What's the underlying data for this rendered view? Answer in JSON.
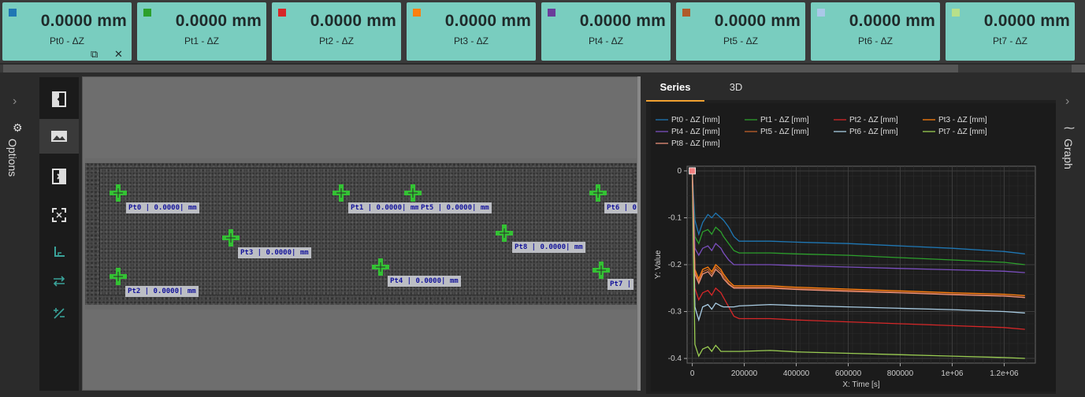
{
  "cards": [
    {
      "value": "0.0000 mm",
      "label": "Pt0 -  ΔZ",
      "color": "#1f77b4"
    },
    {
      "value": "0.0000 mm",
      "label": "Pt1 -  ΔZ",
      "color": "#2ca02c"
    },
    {
      "value": "0.0000 mm",
      "label": "Pt2 -  ΔZ",
      "color": "#d62728"
    },
    {
      "value": "0.0000 mm",
      "label": "Pt3 -  ΔZ",
      "color": "#ff7f0e"
    },
    {
      "value": "0.0000 mm",
      "label": "Pt4 -  ΔZ",
      "color": "#6a3d9a"
    },
    {
      "value": "0.0000 mm",
      "label": "Pt5 -  ΔZ",
      "color": "#b05a2a"
    },
    {
      "value": "0.0000 mm",
      "label": "Pt6 -  ΔZ",
      "color": "#aac8e8"
    },
    {
      "value": "0.0000 mm",
      "label": "Pt7 -  ΔZ",
      "color": "#b8e08a"
    }
  ],
  "card_tools": {
    "copy_icon": "⧉",
    "close_icon": "✕"
  },
  "options_label": "Options",
  "graph_label": "Graph",
  "tabs": [
    {
      "label": "Series"
    },
    {
      "label": "3D"
    }
  ],
  "points": [
    {
      "label": "Pt0 | 0.0000| mm"
    },
    {
      "label": "Pt1 | 0.0000| mm"
    },
    {
      "label": "Pt5 | 0.0000| mm"
    },
    {
      "label": "Pt6 | 0"
    },
    {
      "label": "Pt3 | 0.0000| mm"
    },
    {
      "label": "Pt8 | 0.0000| mm"
    },
    {
      "label": "Pt2 | 0.0000| mm"
    },
    {
      "label": "Pt4 | 0.0000| mm"
    },
    {
      "label": "Pt7 |"
    }
  ],
  "chart_data": {
    "type": "line",
    "xlabel": "X: Time [s]",
    "ylabel": "Y: Value",
    "xlim": [
      -20000,
      1320000
    ],
    "ylim": [
      -0.41,
      0.01
    ],
    "xticks": [
      0,
      200000,
      400000,
      600000,
      800000,
      1000000,
      1200000
    ],
    "xtick_labels": [
      "0",
      "200000",
      "400000",
      "600000",
      "800000",
      "1e+06",
      "1.2e+06"
    ],
    "yticks": [
      0,
      -0.1,
      -0.2,
      -0.3,
      -0.4
    ],
    "ytick_labels": [
      "0",
      "-0.1",
      "-0.2",
      "-0.3",
      "-0.4"
    ],
    "grid": true,
    "legend_placement": "top",
    "series": [
      {
        "name": "Pt0 -  ΔZ [mm]",
        "color": "#1f77b4",
        "x": [
          0,
          10000,
          25000,
          40000,
          60000,
          75000,
          90000,
          100000,
          110000,
          120000,
          140000,
          160000,
          180000,
          300000,
          400000,
          600000,
          800000,
          1000000,
          1200000,
          1280000
        ],
        "y": [
          0,
          -0.105,
          -0.135,
          -0.11,
          -0.093,
          -0.1,
          -0.09,
          -0.095,
          -0.1,
          -0.105,
          -0.12,
          -0.14,
          -0.15,
          -0.15,
          -0.152,
          -0.155,
          -0.16,
          -0.165,
          -0.172,
          -0.177
        ]
      },
      {
        "name": "Pt1 -  ΔZ [mm]",
        "color": "#2ca02c",
        "x": [
          0,
          10000,
          25000,
          40000,
          60000,
          75000,
          90000,
          100000,
          110000,
          120000,
          140000,
          160000,
          180000,
          300000,
          400000,
          600000,
          800000,
          1000000,
          1200000,
          1280000
        ],
        "y": [
          0,
          -0.14,
          -0.155,
          -0.13,
          -0.125,
          -0.135,
          -0.12,
          -0.125,
          -0.13,
          -0.14,
          -0.155,
          -0.17,
          -0.175,
          -0.175,
          -0.177,
          -0.18,
          -0.185,
          -0.19,
          -0.195,
          -0.2
        ]
      },
      {
        "name": "Pt2 -  ΔZ [mm]",
        "color": "#d62728",
        "x": [
          0,
          10000,
          25000,
          40000,
          60000,
          75000,
          90000,
          100000,
          110000,
          120000,
          140000,
          160000,
          180000,
          300000,
          400000,
          600000,
          800000,
          1000000,
          1200000,
          1280000
        ],
        "y": [
          0,
          -0.25,
          -0.275,
          -0.26,
          -0.255,
          -0.265,
          -0.25,
          -0.255,
          -0.26,
          -0.27,
          -0.29,
          -0.31,
          -0.315,
          -0.315,
          -0.318,
          -0.322,
          -0.326,
          -0.33,
          -0.334,
          -0.338
        ]
      },
      {
        "name": "Pt3 -  ΔZ [mm]",
        "color": "#ff7f0e",
        "x": [
          0,
          10000,
          25000,
          40000,
          60000,
          75000,
          90000,
          100000,
          110000,
          120000,
          140000,
          160000,
          180000,
          300000,
          400000,
          600000,
          800000,
          1000000,
          1200000,
          1280000
        ],
        "y": [
          0,
          -0.21,
          -0.23,
          -0.21,
          -0.205,
          -0.215,
          -0.2,
          -0.205,
          -0.21,
          -0.22,
          -0.235,
          -0.245,
          -0.245,
          -0.245,
          -0.248,
          -0.252,
          -0.256,
          -0.26,
          -0.263,
          -0.266
        ]
      },
      {
        "name": "Pt4 -  ΔZ [mm]",
        "color": "#7b4fbf",
        "x": [
          0,
          10000,
          25000,
          40000,
          60000,
          75000,
          90000,
          100000,
          110000,
          120000,
          140000,
          160000,
          180000,
          300000,
          400000,
          600000,
          800000,
          1000000,
          1200000,
          1280000
        ],
        "y": [
          0,
          -0.165,
          -0.18,
          -0.165,
          -0.16,
          -0.17,
          -0.155,
          -0.16,
          -0.165,
          -0.175,
          -0.19,
          -0.2,
          -0.2,
          -0.2,
          -0.202,
          -0.205,
          -0.208,
          -0.211,
          -0.214,
          -0.217
        ]
      },
      {
        "name": "Pt5 -  ΔZ [mm]",
        "color": "#c0602a",
        "x": [
          0,
          10000,
          25000,
          40000,
          60000,
          75000,
          90000,
          100000,
          110000,
          120000,
          140000,
          160000,
          180000,
          300000,
          400000,
          600000,
          800000,
          1000000,
          1200000,
          1280000
        ],
        "y": [
          0,
          -0.215,
          -0.235,
          -0.215,
          -0.21,
          -0.22,
          -0.205,
          -0.21,
          -0.215,
          -0.225,
          -0.24,
          -0.248,
          -0.248,
          -0.248,
          -0.251,
          -0.255,
          -0.259,
          -0.263,
          -0.266,
          -0.27
        ]
      },
      {
        "name": "Pt6 -  ΔZ [mm]",
        "color": "#a9cce3",
        "x": [
          0,
          10000,
          25000,
          40000,
          60000,
          75000,
          90000,
          100000,
          110000,
          120000,
          140000,
          160000,
          180000,
          300000,
          400000,
          600000,
          800000,
          1000000,
          1200000,
          1280000
        ],
        "y": [
          0,
          -0.29,
          -0.318,
          -0.29,
          -0.285,
          -0.295,
          -0.282,
          -0.285,
          -0.288,
          -0.29,
          -0.29,
          -0.29,
          -0.288,
          -0.285,
          -0.287,
          -0.29,
          -0.293,
          -0.296,
          -0.3,
          -0.303
        ]
      },
      {
        "name": "Pt7 -  ΔZ [mm]",
        "color": "#9acd52",
        "x": [
          0,
          10000,
          25000,
          40000,
          60000,
          75000,
          90000,
          100000,
          110000,
          120000,
          140000,
          160000,
          180000,
          300000,
          400000,
          600000,
          800000,
          1000000,
          1200000,
          1280000
        ],
        "y": [
          0,
          -0.37,
          -0.395,
          -0.38,
          -0.375,
          -0.385,
          -0.372,
          -0.378,
          -0.385,
          -0.385,
          -0.385,
          -0.385,
          -0.385,
          -0.383,
          -0.386,
          -0.389,
          -0.392,
          -0.395,
          -0.398,
          -0.4
        ]
      },
      {
        "name": "Pt8 -  ΔZ [mm]",
        "color": "#e8907a",
        "x": [
          0,
          10000,
          25000,
          40000,
          60000,
          75000,
          90000,
          100000,
          110000,
          120000,
          140000,
          160000,
          180000,
          300000,
          400000,
          600000,
          800000,
          1000000,
          1200000,
          1280000
        ],
        "y": [
          0,
          -0.22,
          -0.24,
          -0.22,
          -0.215,
          -0.225,
          -0.21,
          -0.215,
          -0.22,
          -0.23,
          -0.242,
          -0.25,
          -0.25,
          -0.25,
          -0.253,
          -0.257,
          -0.26,
          -0.264,
          -0.267,
          -0.27
        ]
      }
    ]
  }
}
